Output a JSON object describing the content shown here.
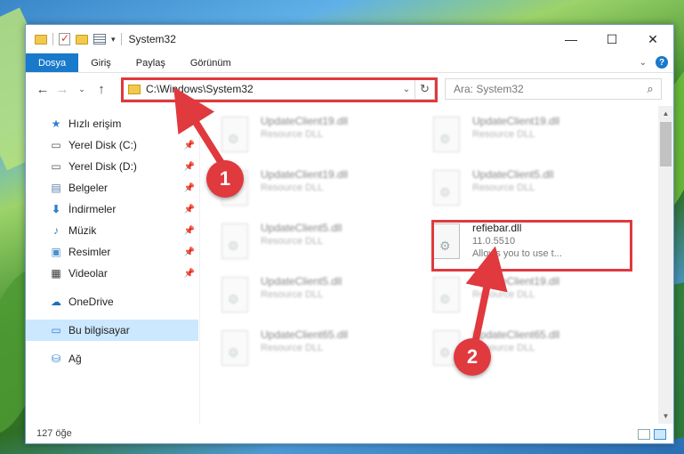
{
  "window": {
    "title": "System32"
  },
  "ribbon": {
    "tabs": [
      "Dosya",
      "Giriş",
      "Paylaş",
      "Görünüm"
    ],
    "help": "?"
  },
  "address": {
    "path": "C:\\Windows\\System32"
  },
  "search": {
    "placeholder": "Ara: System32"
  },
  "sidebar": {
    "items": [
      {
        "label": "Hızlı erişim",
        "icon": "star-icon"
      },
      {
        "label": "Yerel Disk (C:)",
        "icon": "drive-icon"
      },
      {
        "label": "Yerel Disk (D:)",
        "icon": "drive-icon"
      },
      {
        "label": "Belgeler",
        "icon": "document-icon"
      },
      {
        "label": "İndirmeler",
        "icon": "download-icon"
      },
      {
        "label": "Müzik",
        "icon": "music-icon"
      },
      {
        "label": "Resimler",
        "icon": "pictures-icon"
      },
      {
        "label": "Videolar",
        "icon": "video-icon"
      },
      {
        "label": "OneDrive",
        "icon": "cloud-icon"
      },
      {
        "label": "Bu bilgisayar",
        "icon": "computer-icon"
      },
      {
        "label": "Ağ",
        "icon": "network-icon"
      }
    ]
  },
  "files": [
    {
      "name": "UpdateClient19.dll",
      "sub": "Resource DLL"
    },
    {
      "name": "UpdateClient19.dll",
      "sub": "Resource DLL"
    },
    {
      "name": "UpdateClient19.dll",
      "sub": "Resource DLL"
    },
    {
      "name": "UpdateClient5.dll",
      "sub": "Resource DLL"
    },
    {
      "name": "UpdateClient5.dll",
      "sub": "Resource DLL"
    },
    {
      "name": "refiebar.dll",
      "sub": "11.0.5510",
      "desc": "Allows you to use t..."
    },
    {
      "name": "UpdateClient5.dll",
      "sub": "Resource DLL"
    },
    {
      "name": "UpdateClient19.dll",
      "sub": "Resource DLL"
    },
    {
      "name": "UpdateClient65.dll",
      "sub": "Resource DLL"
    },
    {
      "name": "UpdateClient65.dll",
      "sub": "Resource DLL"
    }
  ],
  "status": {
    "count": "127 öğe"
  },
  "annotations": {
    "step1": "1",
    "step2": "2"
  },
  "colors": {
    "accent": "#1979ca",
    "highlight": "#e0393e"
  }
}
